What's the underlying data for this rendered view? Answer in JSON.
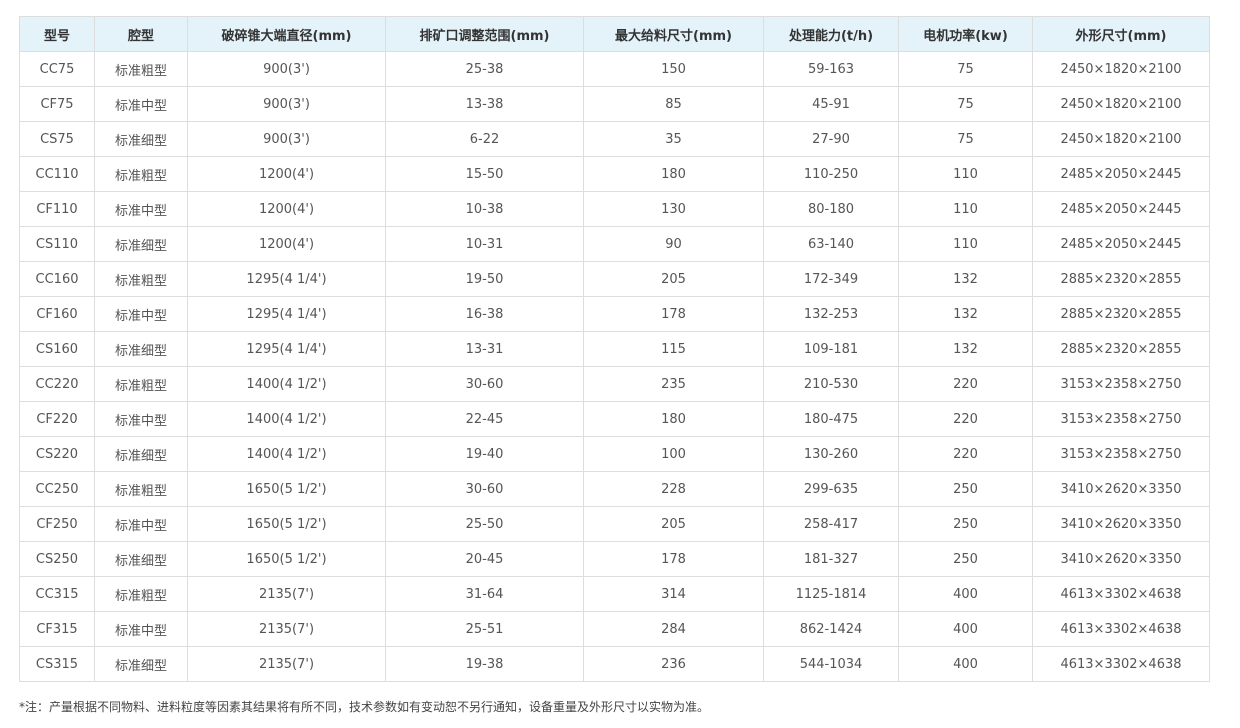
{
  "table": {
    "headers": [
      "型号",
      "腔型",
      "破碎锥大端直径(mm)",
      "排矿口调整范围(mm)",
      "最大给料尺寸(mm)",
      "处理能力(t/h)",
      "电机功率(kw)",
      "外形尺寸(mm)"
    ],
    "rows": [
      [
        "CC75",
        "标准粗型",
        "900(3')",
        "25-38",
        "150",
        "59-163",
        "75",
        "2450×1820×2100"
      ],
      [
        "CF75",
        "标准中型",
        "900(3')",
        "13-38",
        "85",
        "45-91",
        "75",
        "2450×1820×2100"
      ],
      [
        "CS75",
        "标准细型",
        "900(3')",
        "6-22",
        "35",
        "27-90",
        "75",
        "2450×1820×2100"
      ],
      [
        "CC110",
        "标准粗型",
        "1200(4')",
        "15-50",
        "180",
        "110-250",
        "110",
        "2485×2050×2445"
      ],
      [
        "CF110",
        "标准中型",
        "1200(4')",
        "10-38",
        "130",
        "80-180",
        "110",
        "2485×2050×2445"
      ],
      [
        "CS110",
        "标准细型",
        "1200(4')",
        "10-31",
        "90",
        "63-140",
        "110",
        "2485×2050×2445"
      ],
      [
        "CC160",
        "标准粗型",
        "1295(4 1/4')",
        "19-50",
        "205",
        "172-349",
        "132",
        "2885×2320×2855"
      ],
      [
        "CF160",
        "标准中型",
        "1295(4 1/4')",
        "16-38",
        "178",
        "132-253",
        "132",
        "2885×2320×2855"
      ],
      [
        "CS160",
        "标准细型",
        "1295(4 1/4')",
        "13-31",
        "115",
        "109-181",
        "132",
        "2885×2320×2855"
      ],
      [
        "CC220",
        "标准粗型",
        "1400(4 1/2')",
        "30-60",
        "235",
        "210-530",
        "220",
        "3153×2358×2750"
      ],
      [
        "CF220",
        "标准中型",
        "1400(4 1/2')",
        "22-45",
        "180",
        "180-475",
        "220",
        "3153×2358×2750"
      ],
      [
        "CS220",
        "标准细型",
        "1400(4 1/2')",
        "19-40",
        "100",
        "130-260",
        "220",
        "3153×2358×2750"
      ],
      [
        "CC250",
        "标准粗型",
        "1650(5 1/2')",
        "30-60",
        "228",
        "299-635",
        "250",
        "3410×2620×3350"
      ],
      [
        "CF250",
        "标准中型",
        "1650(5 1/2')",
        "25-50",
        "205",
        "258-417",
        "250",
        "3410×2620×3350"
      ],
      [
        "CS250",
        "标准细型",
        "1650(5 1/2')",
        "20-45",
        "178",
        "181-327",
        "250",
        "3410×2620×3350"
      ],
      [
        "CC315",
        "标准粗型",
        "2135(7')",
        "31-64",
        "314",
        "1125-1814",
        "400",
        "4613×3302×4638"
      ],
      [
        "CF315",
        "标准中型",
        "2135(7')",
        "25-51",
        "284",
        "862-1424",
        "400",
        "4613×3302×4638"
      ],
      [
        "CS315",
        "标准细型",
        "2135(7')",
        "19-38",
        "236",
        "544-1034",
        "400",
        "4613×3302×4638"
      ]
    ]
  },
  "note": "*注：产量根据不同物料、进料粒度等因素其结果将有所不同，技术参数如有变动恕不另行通知，设备重量及外形尺寸以实物为准。",
  "colors": {
    "header_bg": "#e4f3fa",
    "border": "#dddddd",
    "text": "#555555"
  }
}
